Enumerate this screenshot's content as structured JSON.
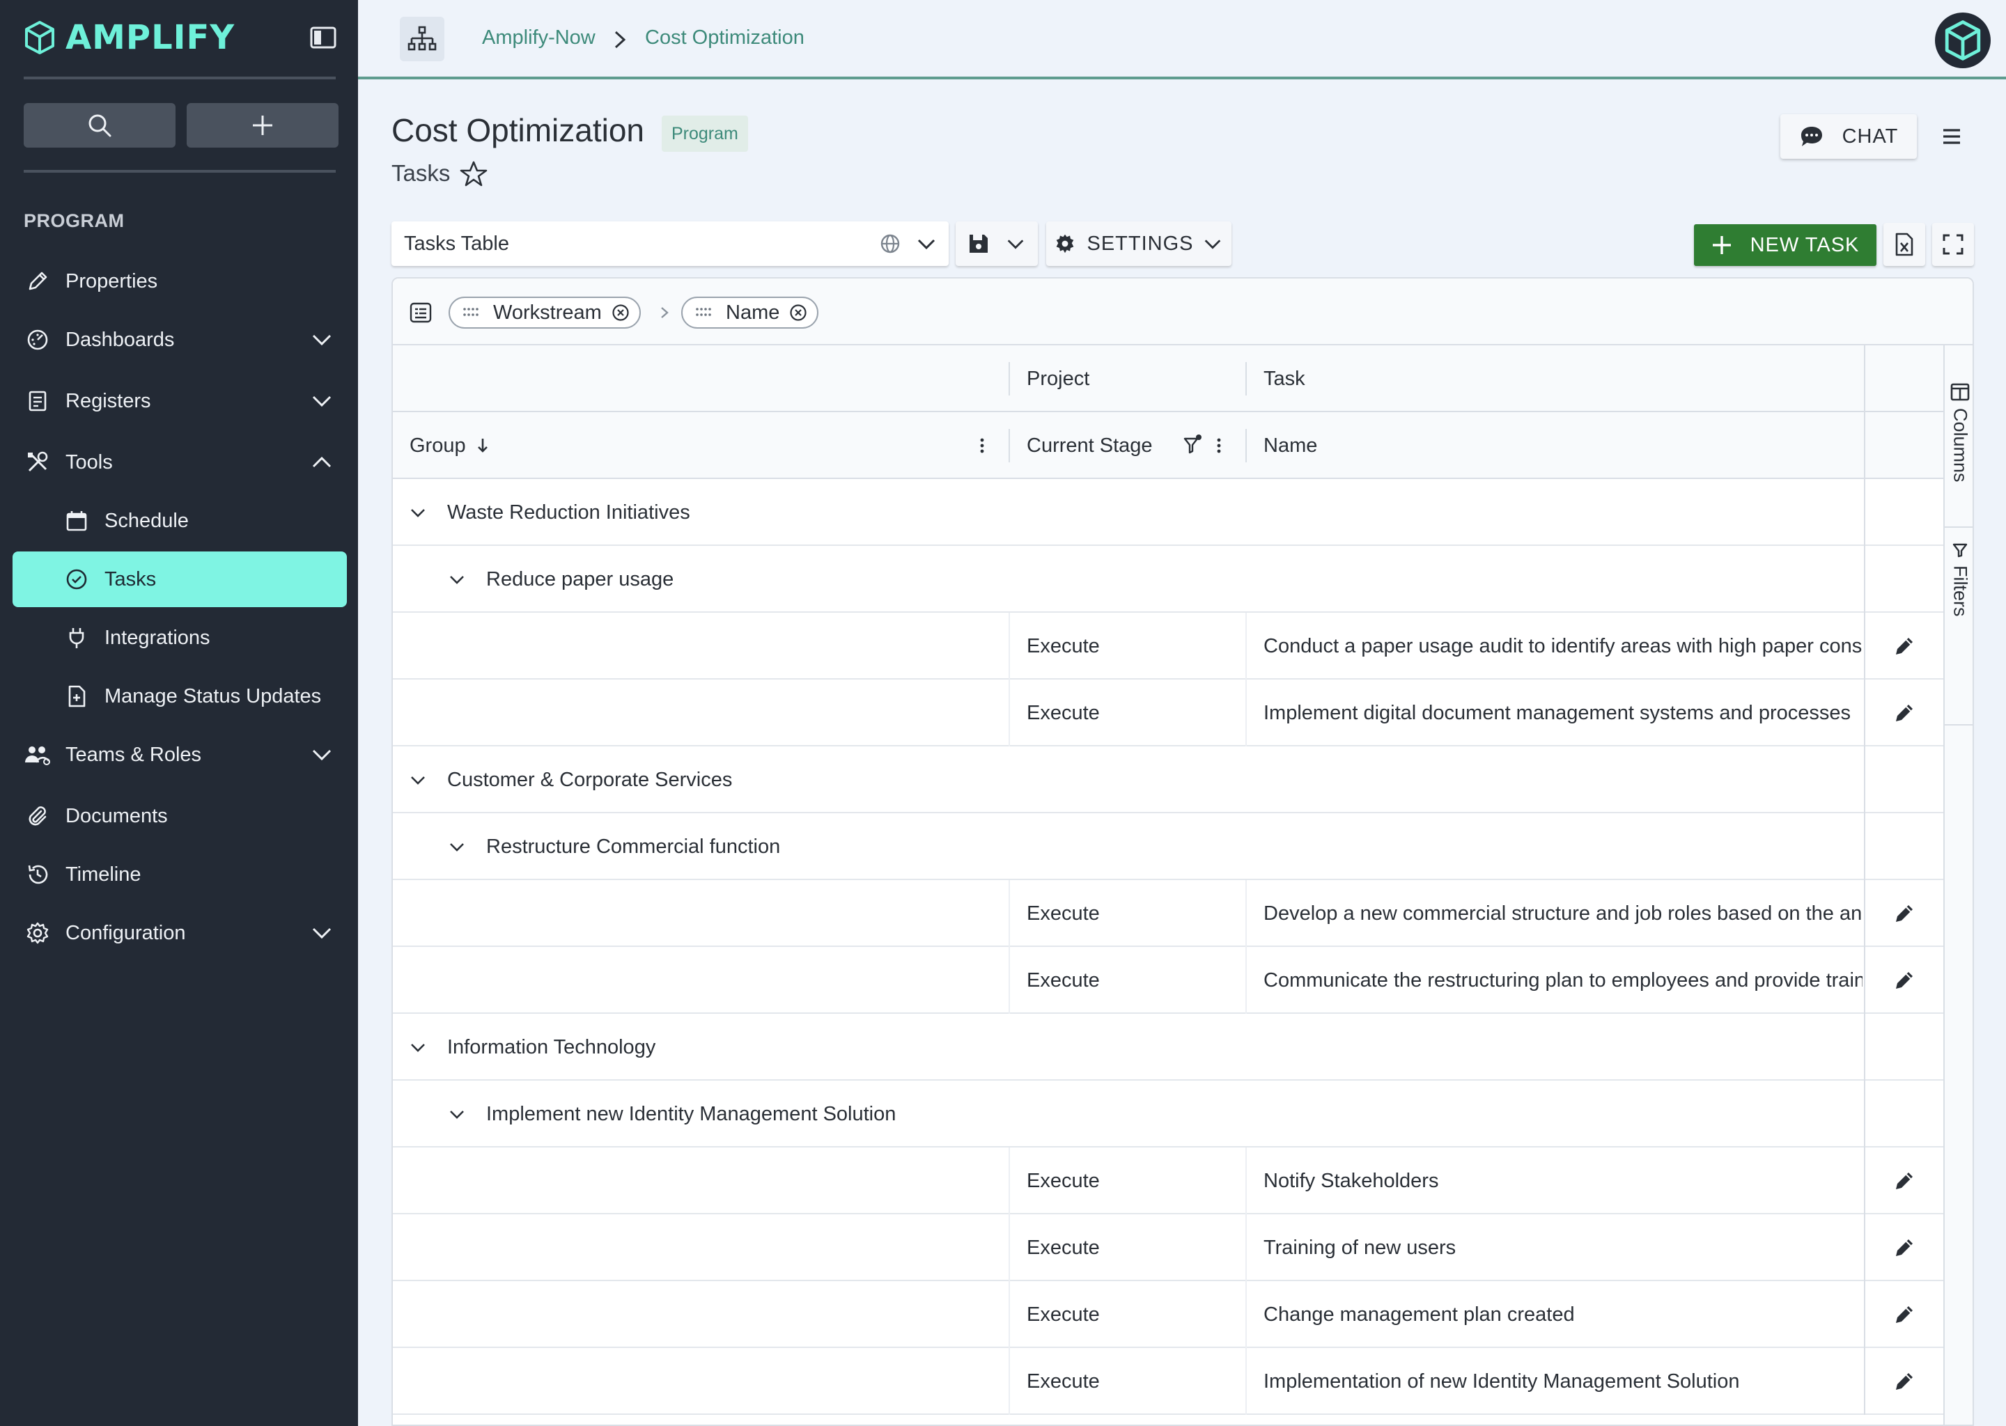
{
  "app": {
    "logo_text": "AMPLIFY"
  },
  "sidebar": {
    "section_label": "PROGRAM",
    "items": [
      {
        "label": "Properties",
        "icon": "pencil-icon"
      },
      {
        "label": "Dashboards",
        "icon": "dashboard-icon"
      },
      {
        "label": "Registers",
        "icon": "register-icon"
      },
      {
        "label": "Tools",
        "icon": "tools-icon"
      },
      {
        "label": "Schedule",
        "icon": "calendar-icon"
      },
      {
        "label": "Tasks",
        "icon": "check-circle-icon"
      },
      {
        "label": "Integrations",
        "icon": "plug-icon"
      },
      {
        "label": "Manage Status Updates",
        "icon": "file-plus-icon"
      },
      {
        "label": "Teams & Roles",
        "icon": "teams-icon"
      },
      {
        "label": "Documents",
        "icon": "paperclip-icon"
      },
      {
        "label": "Timeline",
        "icon": "history-icon"
      },
      {
        "label": "Configuration",
        "icon": "gear-icon"
      }
    ]
  },
  "breadcrumb": {
    "root": "Amplify-Now",
    "current": "Cost Optimization"
  },
  "header": {
    "title": "Cost Optimization",
    "badge": "Program",
    "subtitle": "Tasks",
    "chat_label": "CHAT"
  },
  "toolbar": {
    "view_name": "Tasks Table",
    "settings_label": "SETTINGS",
    "new_task_label": "NEW TASK"
  },
  "grouping": {
    "chips": [
      "Workstream",
      "Name"
    ]
  },
  "table": {
    "header_groups": {
      "project": "Project",
      "task": "Task"
    },
    "columns": {
      "group": "Group",
      "stage": "Current Stage",
      "name": "Name"
    },
    "rows": [
      {
        "type": "group1",
        "label": "Waste Reduction Initiatives"
      },
      {
        "type": "group2",
        "label": "Reduce paper usage"
      },
      {
        "type": "data",
        "stage": "Execute",
        "name": "Conduct a paper usage audit to identify areas with high paper consumption"
      },
      {
        "type": "data",
        "stage": "Execute",
        "name": "Implement digital document management systems and processes"
      },
      {
        "type": "group1",
        "label": "Customer & Corporate Services"
      },
      {
        "type": "group2",
        "label": "Restructure Commercial function"
      },
      {
        "type": "data",
        "stage": "Execute",
        "name": "Develop a new commercial structure and job roles based on the analysis"
      },
      {
        "type": "data",
        "stage": "Execute",
        "name": "Communicate the restructuring plan to employees and provide training"
      },
      {
        "type": "group1",
        "label": "Information Technology"
      },
      {
        "type": "group2",
        "label": "Implement new Identity Management Solution"
      },
      {
        "type": "data",
        "stage": "Execute",
        "name": "Notify Stakeholders"
      },
      {
        "type": "data",
        "stage": "Execute",
        "name": "Training of new users"
      },
      {
        "type": "data",
        "stage": "Execute",
        "name": "Change management plan created"
      },
      {
        "type": "data",
        "stage": "Execute",
        "name": "Implementation of new Identity Management Solution"
      }
    ]
  },
  "side_panels": {
    "columns_label": "Columns",
    "filters_label": "Filters"
  },
  "colors": {
    "sidebar_bg": "#232a35",
    "accent": "#6ef0d9",
    "active_item": "#7ff4e3",
    "primary_button": "#2f7d32",
    "link": "#3d8a7a"
  }
}
